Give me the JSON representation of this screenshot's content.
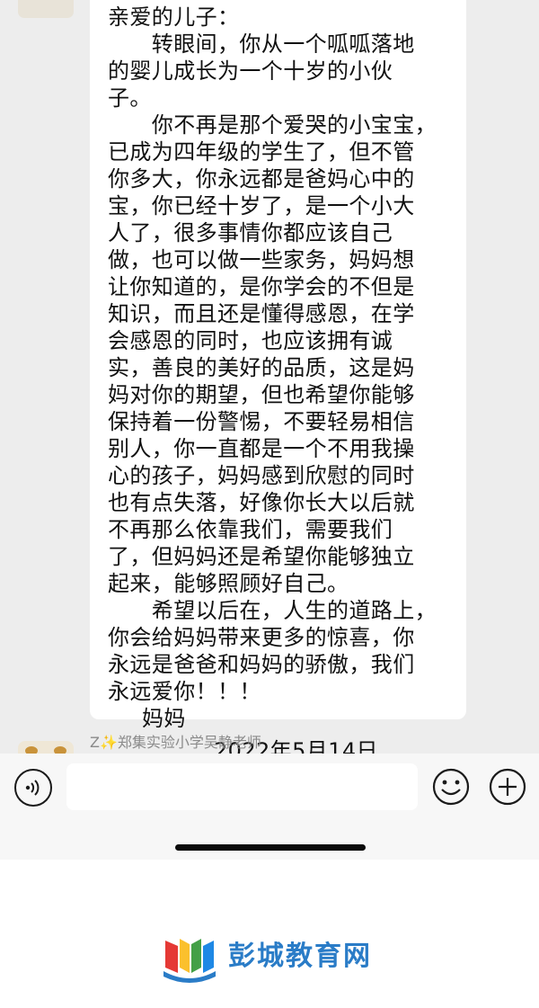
{
  "message": {
    "lines": [
      "亲爱的儿子：",
      "　　转眼间，你从一个呱呱落地",
      "的婴儿成长为一个十岁的小伙",
      "子。",
      "　　你不再是那个爱哭的小宝宝，",
      "已成为四年级的学生了，但不管",
      "你多大，你永远都是爸妈心中的",
      "宝，你已经十岁了，是一个小大",
      "人了，很多事情你都应该自己",
      "做，也可以做一些家务，妈妈想",
      "让你知道的，是你学会的不但是",
      "知识，而且还是懂得感恩，在学",
      "会感恩的同时，也应该拥有诚",
      "实，善良的美好的品质，这是妈",
      "妈对你的期望，但也希望你能够",
      "保持着一份警惕，不要轻易相信",
      "别人，你一直都是一个不用我操",
      "心的孩子，妈妈感到欣慰的同时",
      "也有点失落，好像你长大以后就",
      "不再那么依靠我们，需要我们",
      "了，但妈妈还是希望你能够独立",
      "起来，能够照顾好自己。",
      "　　希望以后在，人生的道路上，",
      "你会给妈妈带来更多的惊喜，你",
      "永远是爸爸和妈妈的骄傲，我们",
      "永远爱你！！！"
    ],
    "signature": "妈妈",
    "date": "2022年5月14日"
  },
  "next_sender": {
    "prefix": "Z",
    "sparkle": "✨",
    "name": "郑集实验小学吴静老师"
  },
  "input_bar": {
    "placeholder": "",
    "voice_icon": "voice-icon",
    "emoji_icon": "emoji-icon",
    "plus_icon": "plus-icon"
  },
  "footer": {
    "brand": "彭城教育网",
    "logo_icon": "book-logo-icon"
  },
  "colors": {
    "chat_background": "#ededed",
    "bubble": "#ffffff",
    "brand_blue": "#2a7cc7"
  }
}
